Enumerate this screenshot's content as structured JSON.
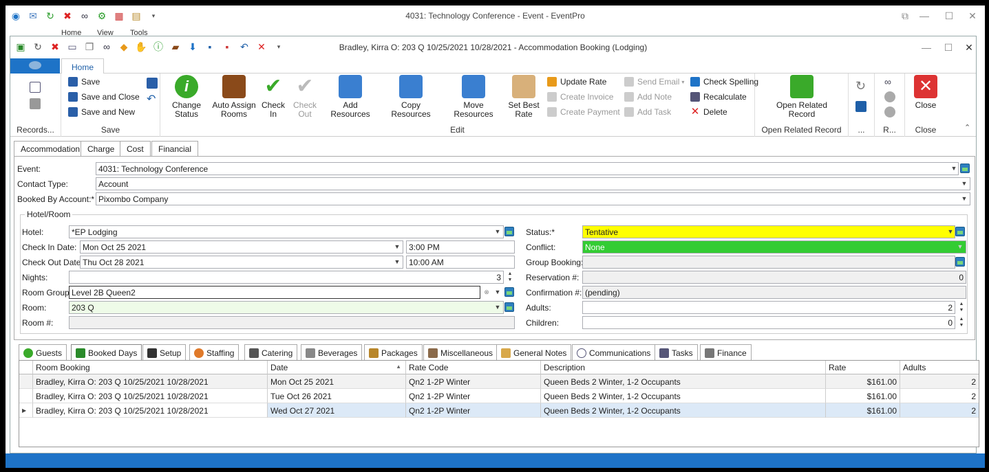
{
  "outer_window": {
    "title": "4031: Technology Conference - Event - EventPro",
    "tabs": [
      "Home",
      "View",
      "Tools"
    ]
  },
  "inner_window": {
    "title": "Bradley, Kirra O: 203 Q 10/25/2021 10/28/2021  - Accommodation Booking (Lodging)"
  },
  "ribbon": {
    "tab": "Home",
    "groups": {
      "records": "Records...",
      "save": "Save",
      "edit": "Edit",
      "open_related": "Open Related Record",
      "more1": "...",
      "more2": "R...",
      "close": "Close"
    },
    "save_items": [
      "Save",
      "Save and Close",
      "Save and New"
    ],
    "big_buttons": {
      "change_status": "Change Status",
      "auto_assign": "Auto Assign Rooms",
      "check_in": "Check In",
      "check_out": "Check Out",
      "add_resources": "Add Resources",
      "copy_resources": "Copy Resources",
      "move_resources": "Move Resources",
      "set_best_rate": "Set Best Rate",
      "open_related": "Open Related Record",
      "close": "Close"
    },
    "col1": [
      "Update Rate",
      "Create Invoice",
      "Create Payment"
    ],
    "col2": [
      "Send Email",
      "Add Note",
      "Add Task"
    ],
    "col3": [
      "Check Spelling",
      "Recalculate",
      "Delete"
    ]
  },
  "form_tabs": [
    "Accommodation",
    "Charge",
    "Cost",
    "Financial"
  ],
  "form": {
    "event_label": "Event:",
    "event_value": "4031: Technology Conference",
    "contact_type_label": "Contact Type:",
    "contact_type_value": "Account",
    "booked_by_label": "Booked By Account:*",
    "booked_by_value": "Pixombo Company",
    "hotel_room_group": "Hotel/Room",
    "hotel_label": "Hotel:",
    "hotel_value": "*EP Lodging",
    "checkin_label": "Check In Date:",
    "checkin_date": "Mon Oct 25 2021",
    "checkin_time": "3:00 PM",
    "checkout_label": "Check Out Date:",
    "checkout_date": "Thu Oct 28 2021",
    "checkout_time": "10:00 AM",
    "nights_label": "Nights:",
    "nights_value": "3",
    "room_group_label": "Room Group:",
    "room_group_value": "Level 2B Queen2",
    "room_label": "Room:",
    "room_value": "203 Q",
    "room_num_label": "Room #:",
    "room_num_value": "",
    "status_label": "Status:*",
    "status_value": "Tentative",
    "conflict_label": "Conflict:",
    "conflict_value": "None",
    "group_booking_label": "Group Booking:",
    "group_booking_value": "",
    "reservation_label": "Reservation #:",
    "reservation_value": "0",
    "confirmation_label": "Confirmation #:",
    "confirmation_value": "(pending)",
    "adults_label": "Adults:",
    "adults_value": "2",
    "children_label": "Children:",
    "children_value": "0",
    "colors": {
      "status": "#ffff00",
      "conflict": "#33cc33"
    }
  },
  "bottom_tabs": [
    "Guests",
    "Booked Days",
    "Setup",
    "Staffing",
    "Catering",
    "Beverages",
    "Packages",
    "Miscellaneous",
    "General Notes",
    "Communications",
    "Tasks",
    "Finance"
  ],
  "grid": {
    "headers": [
      "Room Booking",
      "Date",
      "Rate Code",
      "Description",
      "Rate",
      "Adults"
    ],
    "rows": [
      [
        "Bradley, Kirra O: 203 Q 10/25/2021 10/28/2021",
        "Mon Oct 25 2021",
        "Qn2 1-2P Winter",
        "Queen Beds 2 Winter, 1-2 Occupants",
        "$161.00",
        "2"
      ],
      [
        "Bradley, Kirra O: 203 Q 10/25/2021 10/28/2021",
        "Tue Oct 26 2021",
        "Qn2 1-2P Winter",
        "Queen Beds 2 Winter, 1-2 Occupants",
        "$161.00",
        "2"
      ],
      [
        "Bradley, Kirra O: 203 Q 10/25/2021 10/28/2021",
        "Wed Oct 27 2021",
        "Qn2 1-2P Winter",
        "Queen Beds 2 Winter, 1-2 Occupants",
        "$161.00",
        "2"
      ]
    ]
  }
}
